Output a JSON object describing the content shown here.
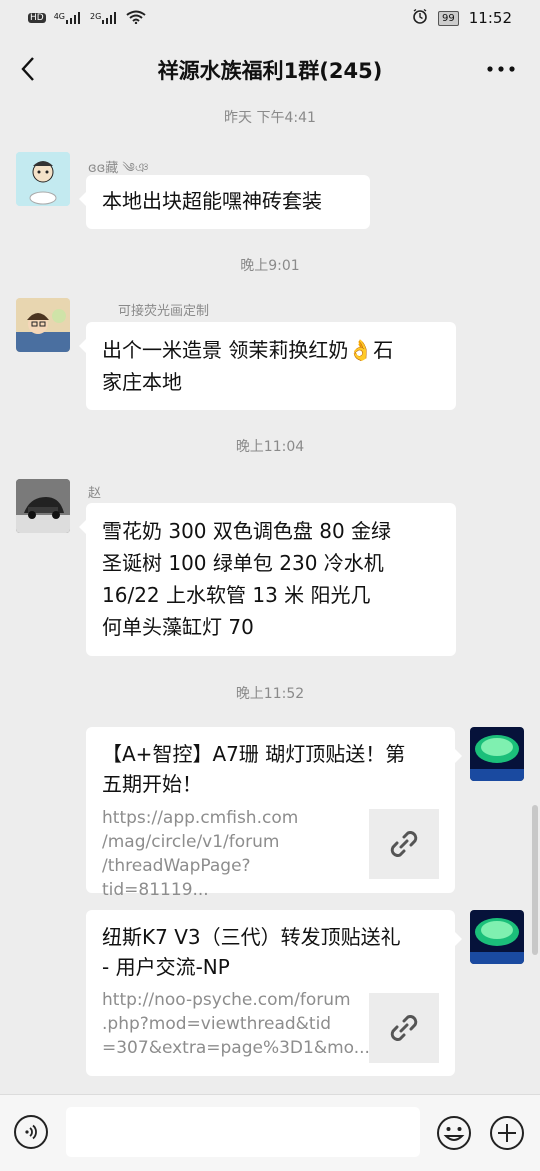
{
  "status_bar": {
    "left_icons": [
      "hd-icon",
      "4g-signal-icon",
      "2g-signal-icon",
      "wifi-icon"
    ],
    "net1": "4G",
    "net2": "2G",
    "battery": "99",
    "time": "11:52"
  },
  "header": {
    "title": "祥源水族福利1群(245)"
  },
  "messages": [
    {
      "type": "timestamp",
      "text": "昨天 下午4:41"
    },
    {
      "type": "text",
      "side": "left",
      "sender": "ɞɞ藏 ༄ঞ",
      "text": "本地出块超能嘿神砖套装"
    },
    {
      "type": "timestamp",
      "text": "晚上9:01"
    },
    {
      "type": "text",
      "side": "left",
      "sender": "可接荧光画定制",
      "lines": [
        "出个一米造景  领茉莉换红奶👌石",
        "家庄本地"
      ]
    },
    {
      "type": "timestamp",
      "text": "晚上11:04"
    },
    {
      "type": "text",
      "side": "left",
      "sender": "赵",
      "lines": [
        "雪花奶  300  双色调色盘 80    金绿",
        "圣诞树 100   绿单包 230     冷水机",
        "16/22 上水软管 13 米           阳光几",
        "何单头藻缸灯 70"
      ]
    },
    {
      "type": "timestamp",
      "text": "晚上11:52"
    },
    {
      "type": "link",
      "side": "right",
      "title_lines": [
        "【A+智控】A7珊 瑚灯顶贴送！第",
        "五期开始！"
      ],
      "url_lines": [
        "https://app.cmfish.com",
        "/mag/circle/v1/forum",
        "/threadWapPage?tid=81119..."
      ]
    },
    {
      "type": "link",
      "side": "right",
      "title_lines": [
        "纽斯K7 V3（三代）转发顶贴送礼",
        "- 用户交流-NP"
      ],
      "url_lines": [
        "http://noo-psyche.com/forum",
        ".php?mod=viewthread&tid",
        "=307&extra=page%3D1&mo..."
      ]
    }
  ],
  "composer": {
    "placeholder": ""
  }
}
